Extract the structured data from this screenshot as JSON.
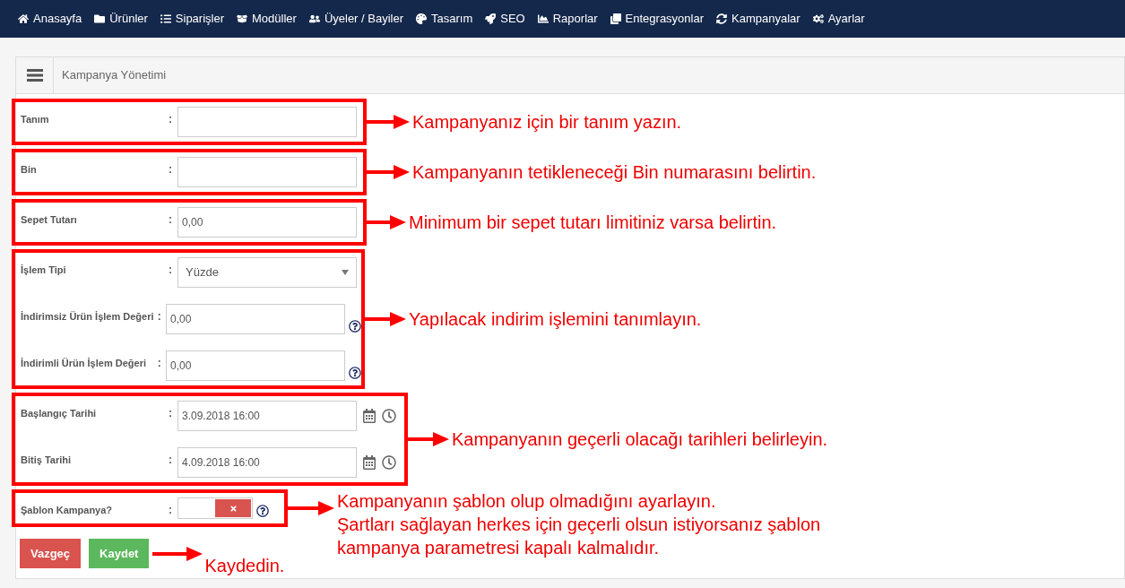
{
  "nav": [
    {
      "label": "Anasayfa"
    },
    {
      "label": "Ürünler"
    },
    {
      "label": "Siparişler"
    },
    {
      "label": "Modüller"
    },
    {
      "label": "Üyeler / Bayiler"
    },
    {
      "label": "Tasarım"
    },
    {
      "label": "SEO"
    },
    {
      "label": "Raporlar"
    },
    {
      "label": "Entegrasyonlar"
    },
    {
      "label": "Kampanyalar"
    },
    {
      "label": "Ayarlar"
    }
  ],
  "panel": {
    "title": "Kampanya Yönetimi"
  },
  "groups": [
    {
      "rows": [
        {
          "kind": "text",
          "label": "Tanım",
          "colon": ":",
          "help": false
        }
      ],
      "note": [
        "Kampanyanız için bir tanım yazın."
      ]
    },
    {
      "rows": [
        {
          "kind": "text",
          "label": "Bin",
          "colon": ":",
          "help": false
        }
      ],
      "note": [
        "Kampanyanın tetikleneceği Bin numarasını belirtin."
      ]
    },
    {
      "rows": [
        {
          "kind": "text",
          "label": "Sepet Tutarı",
          "colon": ":",
          "value": "0,00",
          "help": false
        }
      ],
      "note": [
        "Minimum bir sepet tutarı limitiniz varsa belirtin."
      ]
    },
    {
      "rows": [
        {
          "kind": "select",
          "label": "İşlem Tipi",
          "colon": ":",
          "value": "Yüzde",
          "help": false
        },
        {
          "kind": "text",
          "label": "İndirimsiz Ürün İşlem Değeri",
          "colon": ":",
          "value": "0,00",
          "help": true
        },
        {
          "kind": "text",
          "label": "İndirimli Ürün İşlem Değeri",
          "colon": ":",
          "value": "0,00",
          "help": true
        }
      ],
      "note": [
        "Yapılacak indirim işlemini tanımlayın."
      ]
    },
    {
      "rows": [
        {
          "kind": "datetime",
          "label": "Başlangıç Tarihi",
          "colon": ":",
          "value": "3.09.2018 16:00",
          "help": false
        },
        {
          "kind": "datetime",
          "label": "Bitiş Tarihi",
          "colon": ":",
          "value": "4.09.2018 16:00",
          "help": false
        }
      ],
      "note": [
        "Kampanyanın geçerli olacağı tarihleri belirleyin."
      ]
    },
    {
      "rows": [
        {
          "kind": "toggle",
          "label": "Şablon Kampanya?",
          "colon": ":",
          "on": false,
          "help": true
        }
      ],
      "note": [
        "Kampanyanın şablon olup olmadığını ayarlayın.",
        "Şartları sağlayan herkes için geçerli olsun istiyorsanız şablon",
        "kampanya parametresi kapalı kalmalıdır."
      ]
    }
  ],
  "buttons": [
    {
      "label": "Vazgeç",
      "color": "#d9534f"
    },
    {
      "label": "Kaydet",
      "color": "#5cb85c"
    }
  ],
  "buttons_note": "Kaydedin."
}
